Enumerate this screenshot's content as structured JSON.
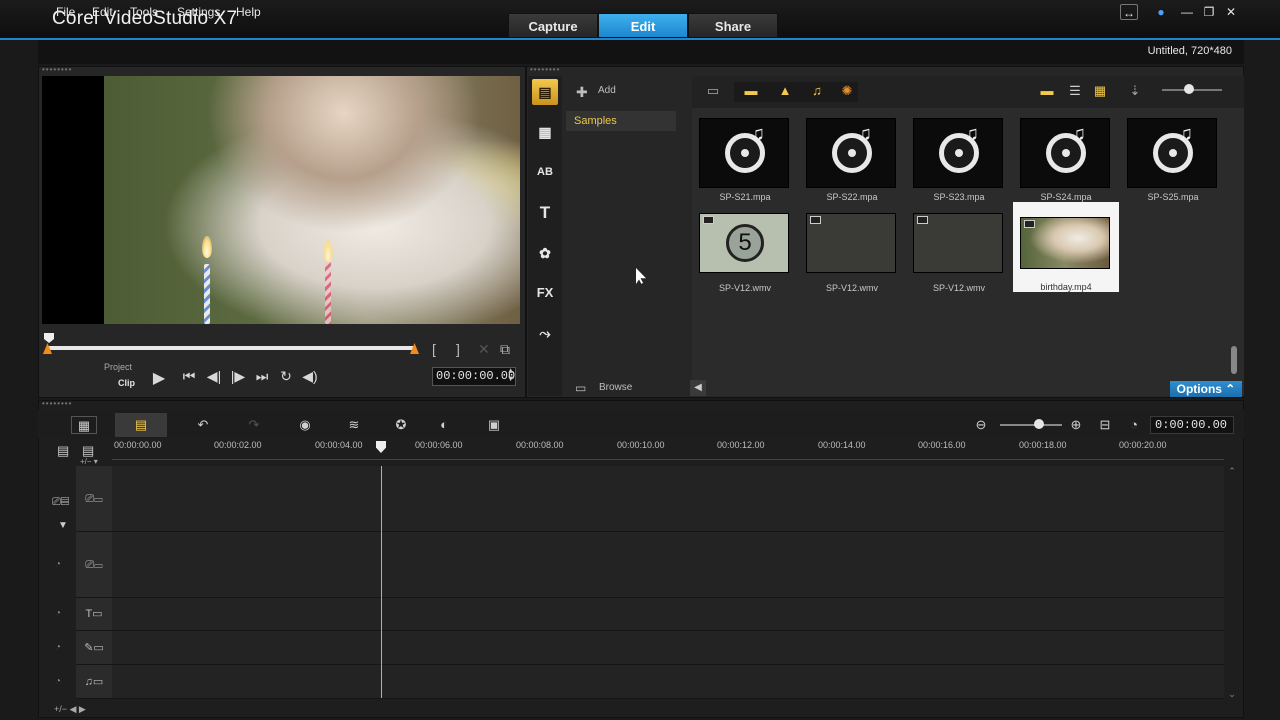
{
  "app": {
    "title": "Corel VideoStudio X7",
    "mode_tabs": [
      "Capture",
      "Edit",
      "Share"
    ],
    "active_mode": "Edit"
  },
  "menu": {
    "items": [
      "File",
      "Edit",
      "Tools",
      "Settings",
      "Help"
    ],
    "project_info": "Untitled, 720*480"
  },
  "player": {
    "mode_project": "Project",
    "mode_clip": "Clip",
    "timecode": "00:00:00.00",
    "mark_in": "[",
    "mark_out": "]"
  },
  "library": {
    "add_label": "Add",
    "folders": [
      "Samples"
    ],
    "browse_label": "Browse",
    "options_label": "Options",
    "side_tabs": [
      "media-tab",
      "instant-project-tab",
      "transition-tab",
      "title-tab",
      "graphic-tab",
      "filter-tab",
      "path-tab"
    ],
    "side_tab_glyphs": {
      "transition": "AB",
      "title": "T",
      "filter": "FX"
    },
    "items": [
      {
        "label": "SP-S21.mpa",
        "kind": "audio"
      },
      {
        "label": "SP-S22.mpa",
        "kind": "audio"
      },
      {
        "label": "SP-S23.mpa",
        "kind": "audio"
      },
      {
        "label": "SP-S24.mpa",
        "kind": "audio"
      },
      {
        "label": "SP-S25.mpa",
        "kind": "audio"
      },
      {
        "label": "SP-V12.wmv",
        "kind": "countdown",
        "digit": "5"
      },
      {
        "label": "SP-V12.wmv",
        "kind": "video"
      },
      {
        "label": "SP-V12.wmv",
        "kind": "video"
      },
      {
        "label": "birthday.mp4",
        "kind": "video",
        "selected": true
      }
    ]
  },
  "timeline": {
    "timecode": "0:00:00.00",
    "ruler_ticks": [
      "00:00:00.00",
      "00:00:02.00",
      "00:00:04.00",
      "00:00:06.00",
      "00:00:08.00",
      "00:00:10.00",
      "00:00:12.00",
      "00:00:14.00",
      "00:00:16.00",
      "00:00:18.00",
      "00:00:20.00"
    ],
    "tracks": [
      "video-track",
      "overlay-track",
      "title-track",
      "voice-track",
      "music-track"
    ]
  },
  "colors": {
    "accent": "#1c87cf",
    "library_tab_active": "#f2c94c",
    "playhead": "#6fc1ff",
    "trim_marker": "#f08b1c"
  }
}
